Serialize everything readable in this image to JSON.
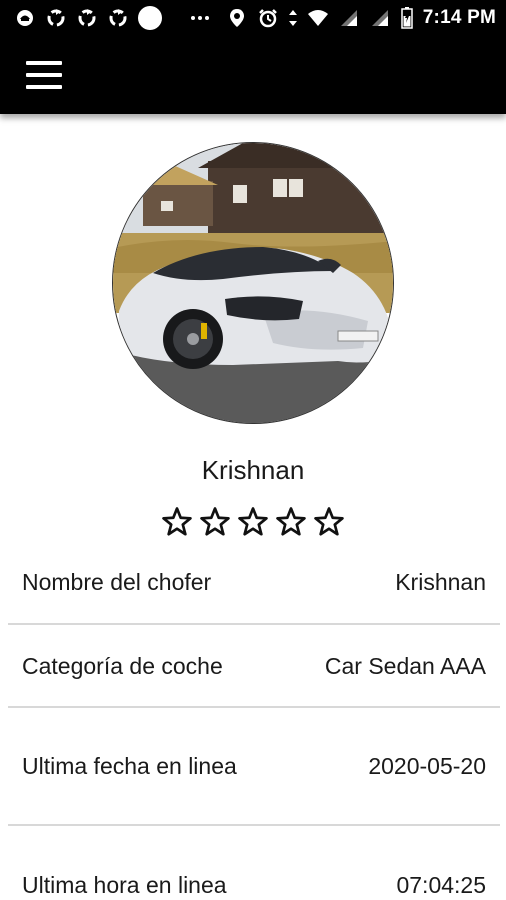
{
  "status_bar": {
    "time": "7:14 PM",
    "left_icons": [
      "notification-icon",
      "sync-icon",
      "sync-icon",
      "sync-icon",
      "circle-icon",
      "more-icon"
    ],
    "right_icons": [
      "location-icon",
      "alarm-icon",
      "data-transfer-icon",
      "wifi-icon",
      "signal-icon",
      "signal-icon",
      "battery-icon"
    ]
  },
  "app_bar": {
    "menu_icon": "hamburger-menu-icon"
  },
  "profile": {
    "driver_name": "Krishnan",
    "rating": 0,
    "rating_max": 5
  },
  "details": [
    {
      "label": "Nombre del chofer",
      "value": "Krishnan"
    },
    {
      "label": "Categoría de coche",
      "value": "Car Sedan AAA"
    },
    {
      "label": "Ultima fecha en linea",
      "value": "2020-05-20"
    },
    {
      "label": "Ultima hora en linea",
      "value": "07:04:25"
    }
  ],
  "colors": {
    "app_bar": "#000000",
    "background": "#ffffff",
    "divider": "#d8d8d8",
    "text": "#1a1a1a"
  }
}
